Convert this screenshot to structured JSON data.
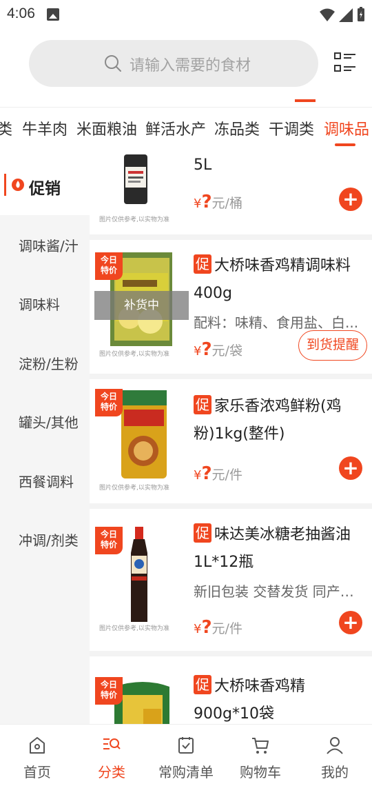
{
  "status_bar": {
    "time": "4:06"
  },
  "search": {
    "placeholder": "请输入需要的食材"
  },
  "categories": [
    {
      "label": "类"
    },
    {
      "label": "牛羊肉"
    },
    {
      "label": "米面粮油"
    },
    {
      "label": "鲜活水产"
    },
    {
      "label": "冻品类"
    },
    {
      "label": "干调类"
    },
    {
      "label": "调味品",
      "active": true
    }
  ],
  "sidebar": {
    "active": "促销",
    "items": [
      {
        "label": "调味酱/汁"
      },
      {
        "label": "调味料"
      },
      {
        "label": "淀粉/生粉"
      },
      {
        "label": "罐头/其他"
      },
      {
        "label": "西餐调料"
      },
      {
        "label": "冲调/剂类"
      }
    ]
  },
  "img_note": "图片仅供参考,以实物为准",
  "promo_badge": {
    "line1": "今日",
    "line2": "特价"
  },
  "promo_tag": "促",
  "price": {
    "currency": "¥",
    "mark": "?"
  },
  "products": [
    {
      "title_tail": "5L",
      "unit": "元/桶"
    },
    {
      "title": "大桥味香鸡精调味料400g",
      "desc": "配料：味精、食用盐、白...",
      "unit": "元/袋",
      "restock_label": "补货中",
      "notify_label": "到货提醒"
    },
    {
      "title": "家乐香浓鸡鲜粉(鸡粉)1kg(整件)",
      "unit": "元/件"
    },
    {
      "title": "味达美冰糖老抽酱油1L*12瓶",
      "desc": "新旧包装 交替发货 同产品...",
      "unit": "元/件"
    },
    {
      "title": "大桥味香鸡精900g*10袋"
    }
  ],
  "bottom_nav": [
    {
      "label": "首页"
    },
    {
      "label": "分类",
      "active": true
    },
    {
      "label": "常购清单"
    },
    {
      "label": "购物车"
    },
    {
      "label": "我的"
    }
  ],
  "colors": {
    "accent": "#f0461f"
  }
}
